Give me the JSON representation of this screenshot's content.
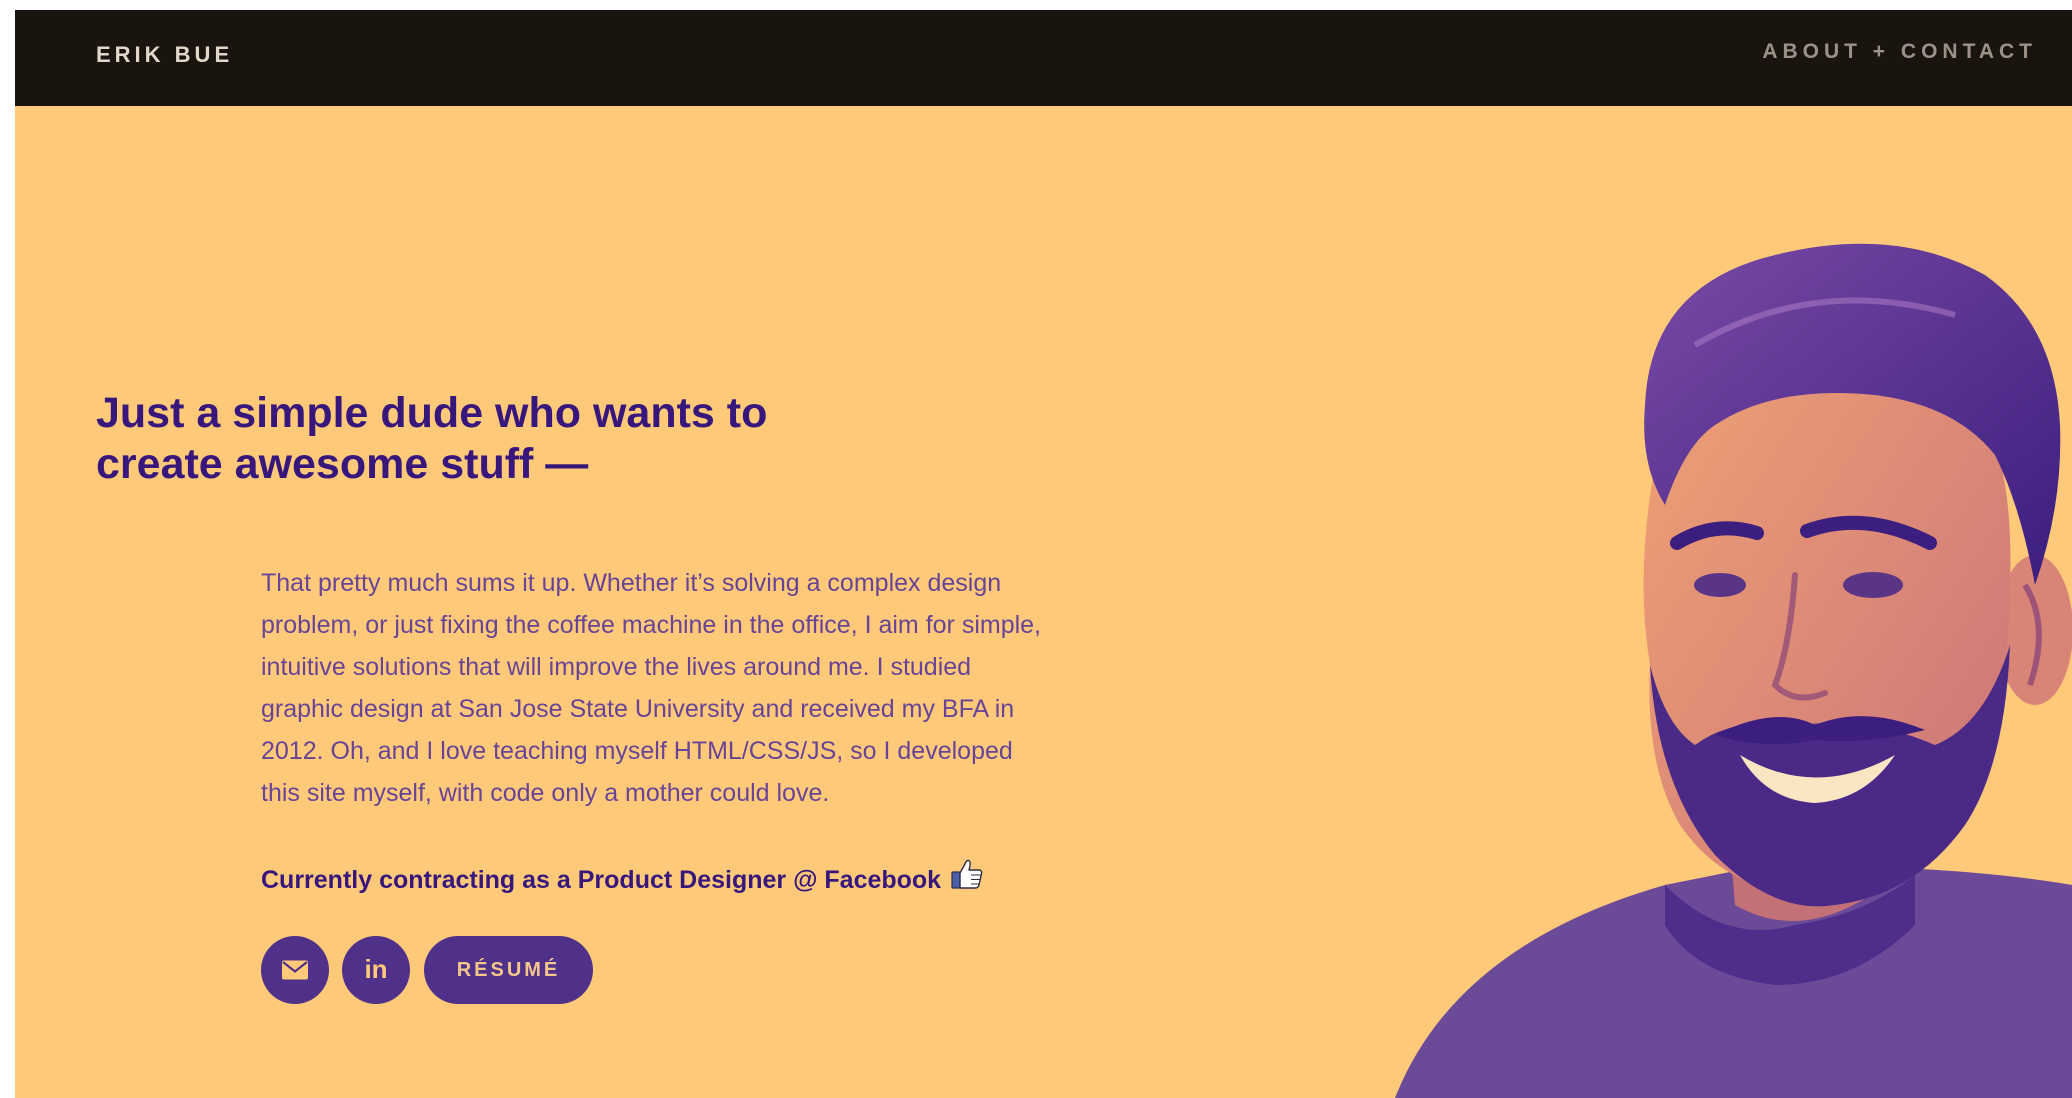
{
  "nav": {
    "brand": "ERIK BUE",
    "link": "ABOUT + CONTACT"
  },
  "hero": {
    "headline": "Just a simple dude who wants to create awesome stuff —",
    "intro": "That pretty much sums it up. Whether it’s solving a complex design problem, or just fixing the coffee machine in the office, I aim for simple, intuitive solutions that will improve the lives around me. I studied graphic design at San Jose State University and received my BFA in 2012. Oh, and I love teaching myself HTML/CSS/JS, so I developed this site myself, with code only a mother could love.",
    "current_role": "Currently contracting as a Product Designer @ Facebook"
  },
  "actions": {
    "email_icon": "envelope-icon",
    "linkedin_icon": "linkedin-icon",
    "linkedin_label": "in",
    "resume_label": "RÉSUMÉ"
  },
  "colors": {
    "background": "#ffc97a",
    "navbar": "#19140e",
    "headline": "#37177c",
    "body_text": "#684496",
    "button": "#503189"
  }
}
